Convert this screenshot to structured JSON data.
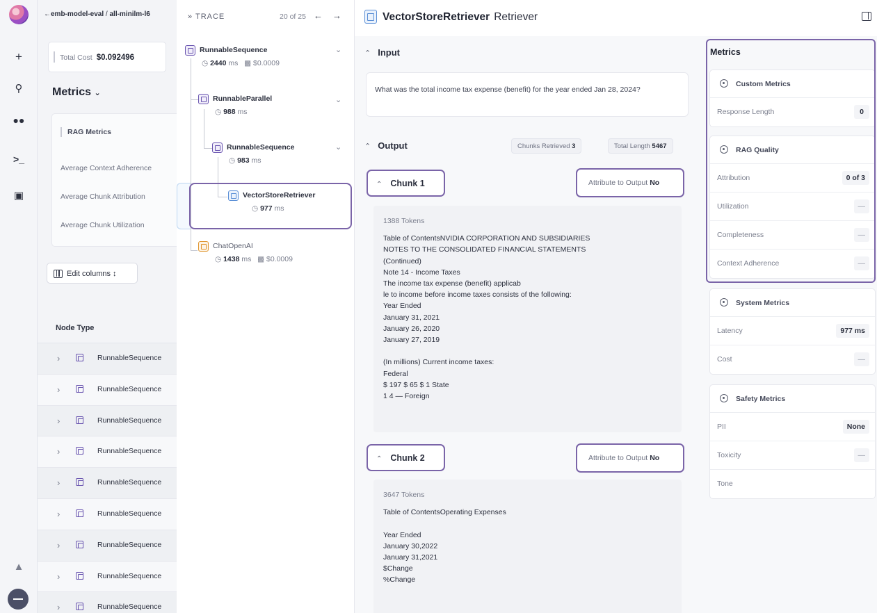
{
  "rail": {
    "icons": [
      "logo-icon",
      "plus-icon",
      "search-icon",
      "glasses-icon",
      "terminal-icon",
      "monitor-icon",
      "flask-icon",
      "avatar"
    ]
  },
  "project": {
    "breadcrumb_back": "←",
    "breadcrumb_project": "emb-model-eval",
    "breadcrumb_sep": " / ",
    "breadcrumb_run": "all-minilm-l6",
    "total_cost_label": "Total Cost",
    "total_cost_value": "$0.092496",
    "metrics_heading": "Metrics",
    "rag_metrics_heading": "RAG Metrics",
    "rag_metrics": [
      "Average Context Adherence",
      "Average Chunk Attribution",
      "Average Chunk Utilization"
    ],
    "edit_columns_label": "Edit columns",
    "table_header": "Node Type",
    "rows": [
      "RunnableSequence",
      "RunnableSequence",
      "RunnableSequence",
      "RunnableSequence",
      "RunnableSequence",
      "RunnableSequence",
      "RunnableSequence",
      "RunnableSequence",
      "RunnableSequence"
    ]
  },
  "trace": {
    "title": "» TRACE",
    "counter": "20 of 25",
    "prev": "←",
    "next": "→",
    "nodes": [
      {
        "name": "RunnableSequence",
        "latency": "2440",
        "unit": "ms",
        "cost": "$0.0009"
      },
      {
        "name": "RunnableParallel",
        "latency": "988",
        "unit": "ms"
      },
      {
        "name": "RunnableSequence",
        "latency": "983",
        "unit": "ms"
      },
      {
        "name": "VectorStoreRetriever",
        "latency": "977",
        "unit": "ms"
      },
      {
        "name": "ChatOpenAI",
        "latency": "1438",
        "unit": "ms",
        "cost": "$0.0009"
      }
    ]
  },
  "detail": {
    "title": "VectorStoreRetriever",
    "subtitle": "Retriever",
    "input_heading": "Input",
    "input_text": "What was the total income tax expense (benefit) for the year ended Jan 28, 2024?",
    "output_heading": "Output",
    "chunks_retrieved_label": "Chunks Retrieved",
    "chunks_retrieved_value": "3",
    "total_length_label": "Total Length",
    "total_length_value": "5467",
    "chunks": [
      {
        "label": "Chunk 1",
        "attribute_label": "Attribute to Output",
        "attribute_value": "No",
        "tokens": "1388 Tokens",
        "lines": [
          "Table of ContentsNVIDIA CORPORATION AND SUBSIDIARIES",
          "NOTES TO THE CONSOLIDATED FINANCIAL STATEMENTS",
          "(Continued)",
          "Note 14 - Income Taxes",
          "The income tax expense (benefit) applicab",
          "le to income before income taxes consists of the following:",
          "Year Ended",
          "January 31, 2021",
          "January 26, 2020",
          "January 27, 2019",
          "",
          "(In millions) Current income taxes:",
          "  Federal",
          "$ 197 $ 65 $ 1 State",
          "1 4 — Foreign"
        ]
      },
      {
        "label": "Chunk 2",
        "attribute_label": "Attribute to Output",
        "attribute_value": "No",
        "tokens": "3647 Tokens",
        "lines": [
          "Table of ContentsOperating Expenses",
          "",
          "Year Ended",
          "January 30,2022",
          "January 31,2021",
          "$Change",
          "%Change"
        ]
      }
    ]
  },
  "metrics": {
    "title": "Metrics",
    "groups": [
      {
        "name": "Custom Metrics",
        "rows": [
          {
            "label": "Response Length",
            "value": "0"
          }
        ]
      },
      {
        "name": "RAG Quality",
        "rows": [
          {
            "label": "Attribution",
            "value": "0 of 3"
          },
          {
            "label": "Utilization",
            "value": "—"
          },
          {
            "label": "Completeness",
            "value": "—"
          },
          {
            "label": "Context Adherence",
            "value": "—"
          }
        ]
      },
      {
        "name": "System Metrics",
        "rows": [
          {
            "label": "Latency",
            "value": "977 ms"
          },
          {
            "label": "Cost",
            "value": "—"
          }
        ]
      },
      {
        "name": "Safety Metrics",
        "rows": [
          {
            "label": "PII",
            "value": "None"
          },
          {
            "label": "Toxicity",
            "value": "—"
          },
          {
            "label": "Tone",
            "value": ""
          }
        ]
      }
    ]
  }
}
